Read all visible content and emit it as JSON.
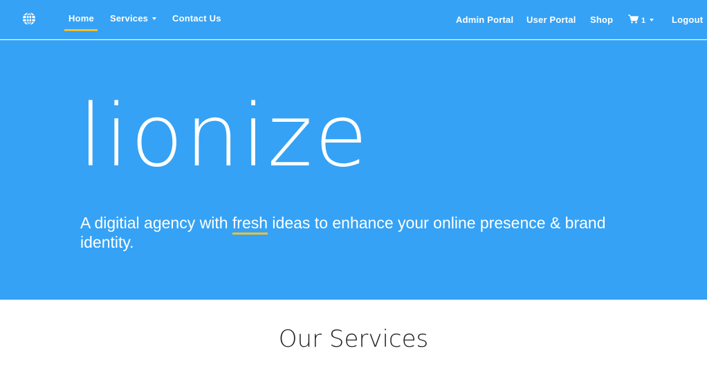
{
  "nav": {
    "left": [
      {
        "label": "Home",
        "active": true
      },
      {
        "label": "Services",
        "dropdown": true
      },
      {
        "label": "Contact Us"
      }
    ],
    "right": [
      {
        "label": "Admin Portal"
      },
      {
        "label": "User Portal"
      },
      {
        "label": "Shop"
      },
      {
        "label": "Logout"
      }
    ],
    "cart": {
      "icon": "cart-icon",
      "count": "1",
      "dropdown": true
    },
    "logo_icon": "globe-icon"
  },
  "hero": {
    "brand": "lionize",
    "tagline_before": "A digitial agency with ",
    "tagline_highlight": "fresh",
    "tagline_after": " ideas to enhance your online presence & brand identity."
  },
  "services": {
    "title": "Our Services"
  },
  "colors": {
    "primary": "#35a2f5",
    "accent": "#f2c12e",
    "text_dark": "#222222"
  }
}
